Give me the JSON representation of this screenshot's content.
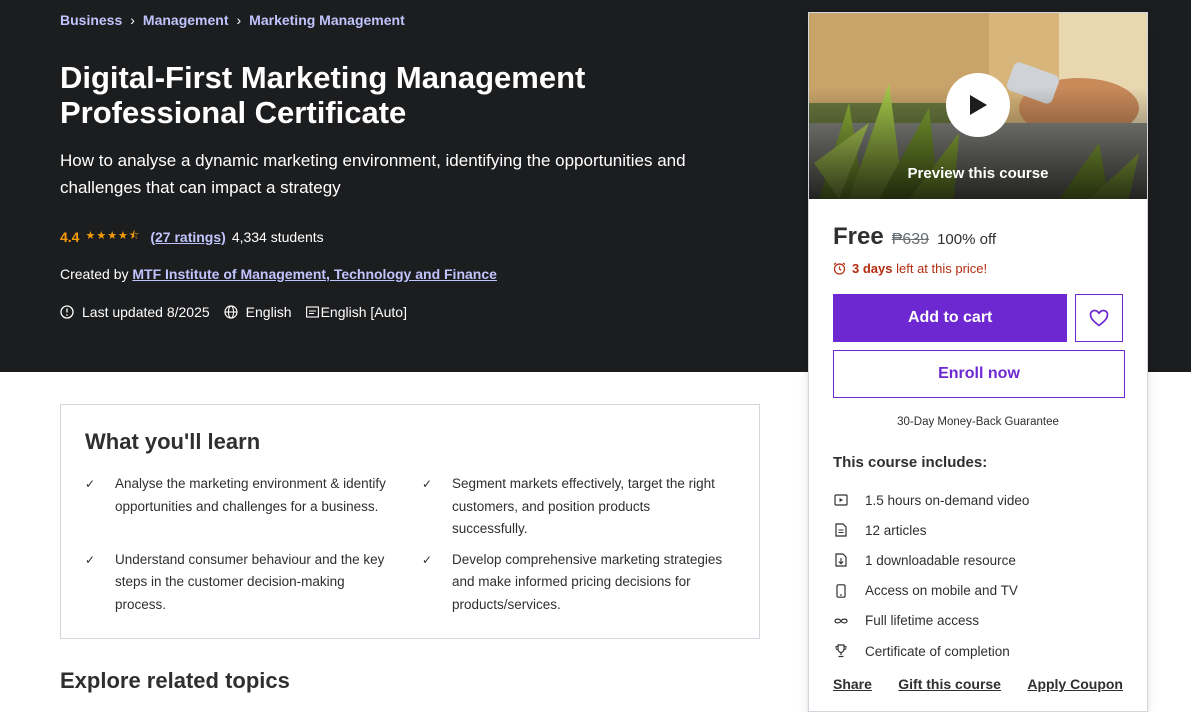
{
  "breadcrumb": [
    "Business",
    "Management",
    "Marketing Management"
  ],
  "course": {
    "title": "Digital-First Marketing Management Professional Certificate",
    "subtitle": "How to analyse a dynamic marketing environment, identifying the opportunities and challenges that can impact a strategy",
    "rating": "4.4",
    "ratings_count": "(27 ratings)",
    "students": "4,334 students",
    "created_by_label": "Created by",
    "instructor": "MTF Institute of Management, Technology and Finance",
    "last_updated": "Last updated 8/2025",
    "language": "English",
    "captions": "English [Auto]"
  },
  "learn": {
    "title": "What you'll learn",
    "items": [
      "Analyse the marketing environment & identify opportunities and challenges for a business.",
      "Segment markets effectively, target the right customers, and position products successfully.",
      "Understand consumer behaviour and the key steps in the customer decision-making process.",
      "Develop comprehensive marketing strategies and make informed pricing decisions for products/services."
    ]
  },
  "explore_title": "Explore related topics",
  "sidebar": {
    "preview_label": "Preview this course",
    "price": "Free",
    "original_price": "₱639",
    "discount": "100% off",
    "timer_days": "3 days",
    "timer_rest": "left at this price!",
    "add_to_cart": "Add to cart",
    "enroll": "Enroll now",
    "guarantee": "30-Day Money-Back Guarantee",
    "includes_title": "This course includes:",
    "includes": [
      {
        "icon": "video-icon",
        "text": "1.5 hours on-demand video"
      },
      {
        "icon": "article-icon",
        "text": "12 articles"
      },
      {
        "icon": "download-icon",
        "text": "1 downloadable resource"
      },
      {
        "icon": "mobile-icon",
        "text": "Access on mobile and TV"
      },
      {
        "icon": "infinity-icon",
        "text": "Full lifetime access"
      },
      {
        "icon": "trophy-icon",
        "text": "Certificate of completion"
      }
    ],
    "share": "Share",
    "gift": "Gift this course",
    "coupon": "Apply Coupon"
  },
  "colors": {
    "hero_bg": "#1c1d1f",
    "accent": "#6d28d2",
    "link": "#c0c4fc",
    "rating": "#f69c08",
    "timer": "#b32d0f"
  }
}
